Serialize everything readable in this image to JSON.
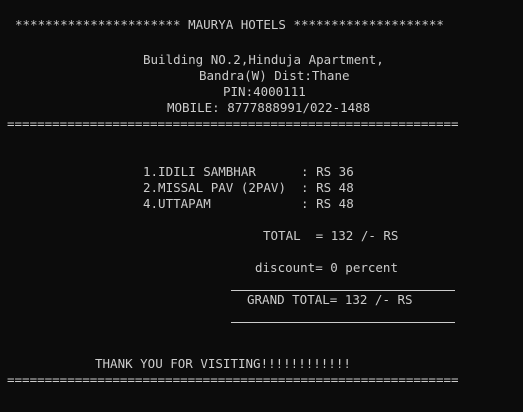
{
  "receipt": {
    "header": "********************** MAURYA HOTELS ********************",
    "address_line1": "Building NO.2,Hinduja Apartment,",
    "address_line2": "Bandra(W) Dist:Thane",
    "pin": "PIN:4000111",
    "mobile": "MOBILE: 8777888991/022-1488",
    "separator": "============================================================",
    "items": [
      {
        "line": "1.IDILI SAMBHAR      : RS 36"
      },
      {
        "line": "2.MISSAL PAV (2PAV)  : RS 48"
      },
      {
        "line": "4.UTTAPAM            : RS 48"
      }
    ],
    "total": "TOTAL  = 132 /- RS",
    "discount": "discount= 0 percent",
    "grand_total": "GRAND TOTAL= 132 /- RS",
    "thank_you": "THANK YOU FOR VISITING!!!!!!!!!!!!",
    "bottom_separator": "============================================================"
  }
}
